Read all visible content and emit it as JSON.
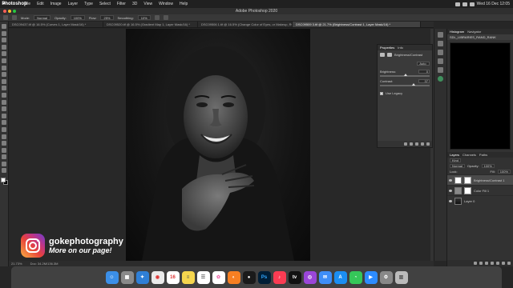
{
  "menubar": {
    "items": [
      "Photoshop",
      "File",
      "Edit",
      "Image",
      "Layer",
      "Type",
      "Select",
      "Filter",
      "3D",
      "View",
      "Window",
      "Help"
    ],
    "clock": "Wed 16 Dec  12:05"
  },
  "window": {
    "title": "Adobe Photoshop 2020"
  },
  "options": {
    "mode_label": "Mode:",
    "mode_value": "Normal",
    "opacity_label": "Opacity:",
    "opacity_value": "100%",
    "flow_label": "Flow:",
    "flow_value": "25%",
    "smoothing_label": "Smoothing:",
    "smoothing_value": "10%"
  },
  "tabs": [
    {
      "label": "DSC09437.tif @ 16.5% (Curves 1, Layer Mask/16) *",
      "active": false
    },
    {
      "label": "DSC09520.tif @ 16.5% (Gradient Map 1, Layer Mask/16) *",
      "active": false
    },
    {
      "label": "DSC09506 1.tif @ 16.5% (Change Color of Eyes, or Makeup, RGB/16) *",
      "active": false
    },
    {
      "label": "DSC09509 3.tif @ 21.7% (Brightness/Contrast 1, Layer Mask/16) *",
      "active": true
    }
  ],
  "status": {
    "zoom": "21.73%",
    "doc": "Doc: 34.2M/136.3M"
  },
  "properties": {
    "tabs": [
      "Properties",
      "Info"
    ],
    "adjustment_name": "Brightness/Contrast",
    "auto_label": "Auto",
    "brightness_label": "Brightness:",
    "brightness_value": "0",
    "contrast_label": "Contrast:",
    "contrast_value": "37",
    "legacy_label": "Use Legacy"
  },
  "right_panel": {
    "top_tabs": [
      "Histogram",
      "Navigator"
    ],
    "library": "SDL_LIBRARIES_RAND_RANK",
    "layer_tabs": [
      "Layers",
      "Channels",
      "Paths"
    ],
    "kind_label": "Kind",
    "blend_mode": "Normal",
    "opacity_label": "Opacity:",
    "opacity_value": "100%",
    "lock_label": "Lock:",
    "fill_label": "Fill:",
    "fill_value": "100%",
    "layers": [
      {
        "name": "Brightness/Contrast 1",
        "type": "adjustment",
        "selected": true
      },
      {
        "name": "Color Fill 1",
        "type": "fill",
        "selected": false
      },
      {
        "name": "Layer 0",
        "type": "image",
        "selected": false
      }
    ]
  },
  "watermark": {
    "handle": "gokephotography",
    "tagline": "More on our page!"
  },
  "dock_apps": [
    "Finder",
    "Launchpad",
    "Safari",
    "Chrome",
    "Calendar",
    "Notes",
    "Reminders",
    "Photos",
    "Firefox",
    "Photoshop",
    "Music",
    "TV",
    "Podcasts",
    "Mail",
    "App Store",
    "Messages",
    "Zoom",
    "Settings",
    "Trash"
  ],
  "colors": {
    "ps_blue": "#31a8ff",
    "accent_green": "#3f8f5d"
  }
}
